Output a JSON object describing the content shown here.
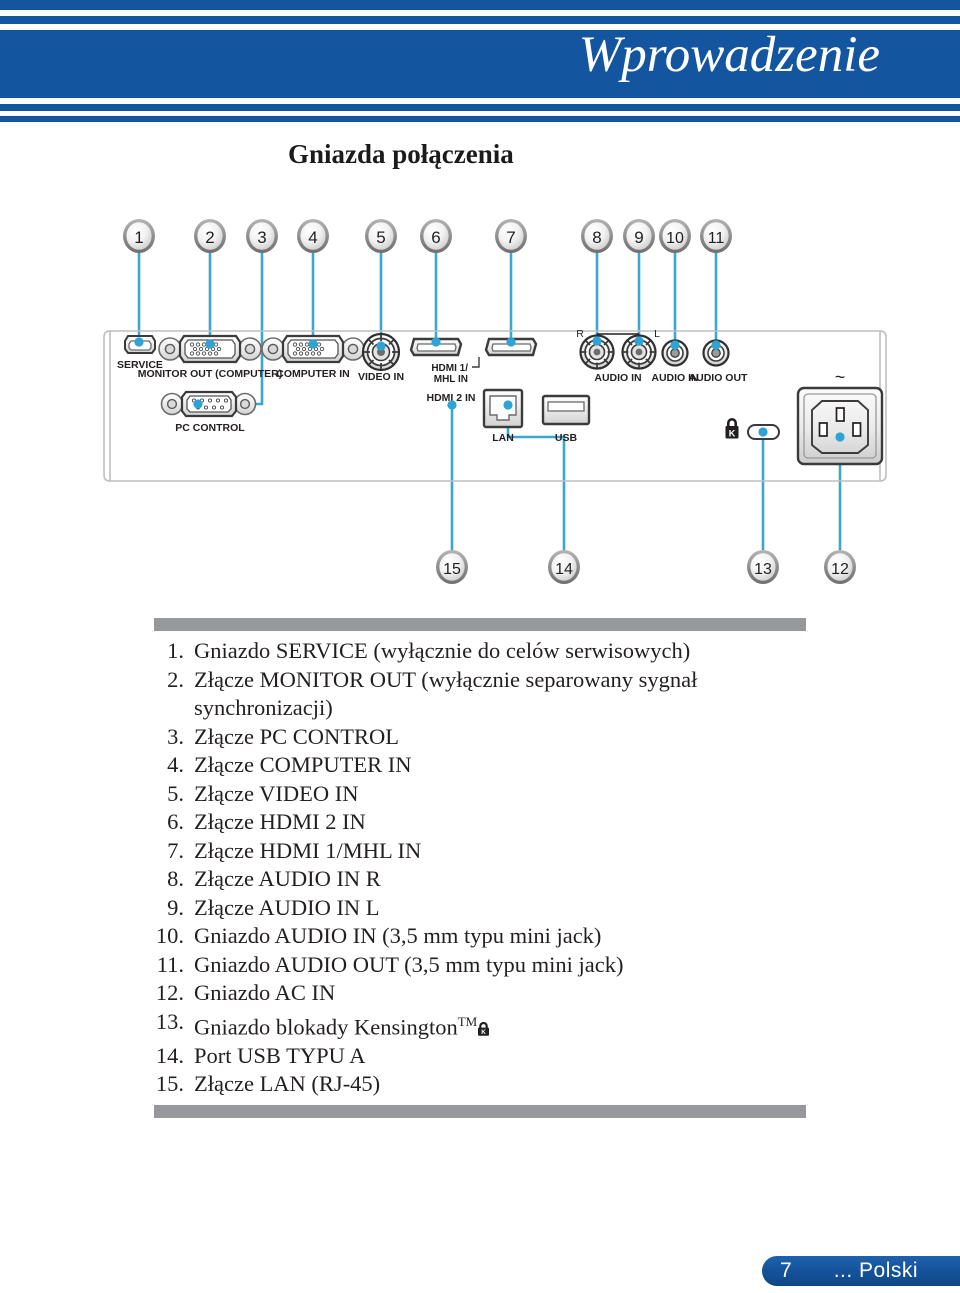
{
  "header": {
    "title": "Wprowadzenie",
    "band_color": "#14559f"
  },
  "section": {
    "title": "Gniazda połączenia"
  },
  "diagram": {
    "callout_line_color": "#3aa7cf",
    "panel_outline_color": "#b9bdc0",
    "top_callouts": [
      "1",
      "2",
      "3",
      "4",
      "5",
      "6",
      "7",
      "8",
      "9",
      "10",
      "11"
    ],
    "bottom_callouts": [
      "15",
      "14",
      "13",
      "12"
    ],
    "port_labels": {
      "service": "SERVICE",
      "monitor_out": "MONITOR OUT (COMPUTER)",
      "pc_control": "PC  CONTROL",
      "computer_in": "COMPUTER  IN",
      "video_in": "VIDEO IN",
      "hdmi1_mhl_in_line1": "HDMI 1/",
      "hdmi1_mhl_in_line2": "MHL IN",
      "hdmi2_in": "HDMI 2 IN",
      "lan": "LAN",
      "usb": "USB",
      "audio_in_rca": "AUDIO IN",
      "audio_in_mini": "AUDIO IN",
      "audio_out": "AUDIO OUT",
      "rca_r": "R",
      "rca_l": "L",
      "ac_tilde": "~"
    }
  },
  "list": {
    "items": [
      {
        "num": "1.",
        "text": "Gniazdo SERVICE (wyłącznie do celów serwisowych)"
      },
      {
        "num": "2.",
        "text": "Złącze MONITOR OUT (wyłącznie separowany sygnał synchronizacji)"
      },
      {
        "num": "3.",
        "text": "Złącze PC CONTROL"
      },
      {
        "num": "4.",
        "text": "Złącze COMPUTER IN"
      },
      {
        "num": "5.",
        "text": "Złącze VIDEO IN"
      },
      {
        "num": "6.",
        "text": "Złącze HDMI 2 IN"
      },
      {
        "num": "7.",
        "text": "Złącze HDMI 1/MHL IN"
      },
      {
        "num": "8.",
        "text": "Złącze AUDIO IN R"
      },
      {
        "num": "9.",
        "text": "Złącze AUDIO IN L"
      },
      {
        "num": "10.",
        "text": "Gniazdo AUDIO IN (3,5 mm typu mini jack)"
      },
      {
        "num": "11.",
        "text": "Gniazdo AUDIO OUT (3,5 mm typu mini jack)"
      },
      {
        "num": "12.",
        "text": "Gniazdo AC IN"
      },
      {
        "num": "13.",
        "text": "Gniazdo blokady Kensington",
        "sup": "TM",
        "icon": "kensington-lock-icon"
      },
      {
        "num": "14.",
        "text": "Port USB TYPU A"
      },
      {
        "num": "15.",
        "text": "Złącze LAN (RJ-45)"
      }
    ]
  },
  "footer": {
    "page_number": "7",
    "language": "... Polski",
    "pill_color": "#14559f"
  }
}
